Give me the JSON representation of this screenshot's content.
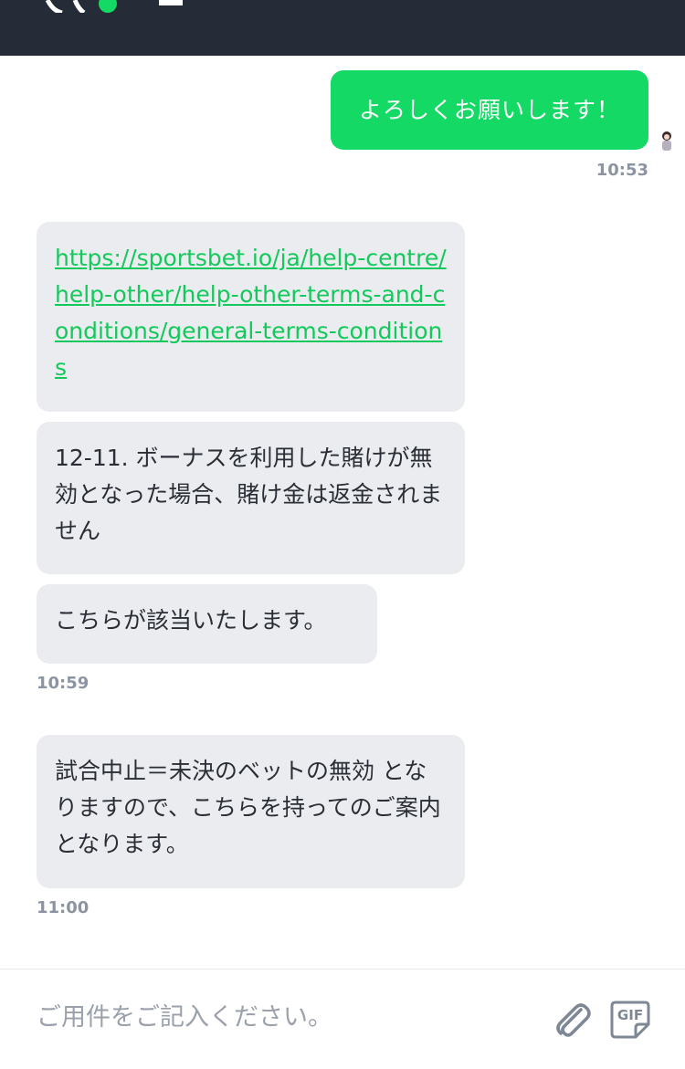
{
  "header": {
    "logo_icon": "sportsbet-logo-icon",
    "background": "#252b37"
  },
  "messages": {
    "m1": {
      "text": "よろしくお願いします！",
      "time": "10:53"
    },
    "m2": {
      "link": "https://sportsbet.io/ja/help-centre/help-other/help-other-terms-and-conditions/general-terms-conditions"
    },
    "m3": {
      "text": "12-11. ボーナスを利用した賭けが無効となった場合、賭け金は返金されません"
    },
    "m4": {
      "text": "こちらが該当いたします。",
      "time": "10:59"
    },
    "m5": {
      "text": "試合中止＝未決のベットの無効 となりますので、こちらを持ってのご案内となります。",
      "time": "11:00"
    }
  },
  "composer": {
    "placeholder": "ご用件をご記入ください。",
    "attach_icon": "paperclip-icon",
    "gif_icon": "gif-icon"
  },
  "colors": {
    "accent": "#14d964",
    "link": "#14c95c",
    "bubble": "#ebecef",
    "timestamp": "#8b94a0"
  }
}
